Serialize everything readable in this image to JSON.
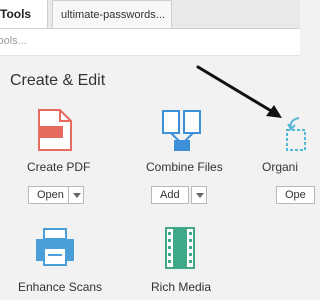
{
  "tabs": {
    "tools": "Tools",
    "document": "ultimate-passwords..."
  },
  "search": {
    "placeholder": "Tools..."
  },
  "section": {
    "title": "Create & Edit"
  },
  "tools": [
    {
      "label": "Create PDF",
      "button": "Open",
      "has_dropdown": true,
      "icon": "create-pdf-icon",
      "color": "#e46b5e"
    },
    {
      "label": "Combine Files",
      "button": "Add",
      "has_dropdown": true,
      "icon": "combine-files-icon",
      "color": "#3d8fd8"
    },
    {
      "label": "Organi",
      "button": "Ope",
      "has_dropdown": false,
      "icon": "organize-pages-icon",
      "color": "#55b8d6"
    },
    {
      "label": "Enhance Scans",
      "icon": "enhance-scans-icon",
      "color": "#4a9fd9"
    },
    {
      "label": "Rich Media",
      "icon": "rich-media-icon",
      "color": "#3fa98a"
    }
  ],
  "annotation": {
    "icon": "arrow-annotation-icon",
    "color": "#111111"
  }
}
